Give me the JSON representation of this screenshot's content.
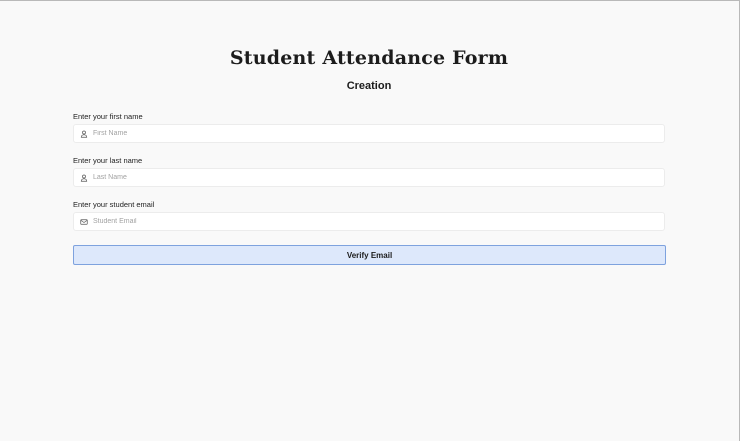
{
  "header": {
    "title": "Student Attendance Form",
    "subtitle": "Creation"
  },
  "form": {
    "fields": [
      {
        "label": "Enter your first name",
        "placeholder": "First Name",
        "value": "",
        "icon": "user-icon"
      },
      {
        "label": "Enter your last name",
        "placeholder": "Last Name",
        "value": "",
        "icon": "user-icon"
      },
      {
        "label": "Enter your student email",
        "placeholder": "Student Email",
        "value": "",
        "icon": "mail-icon"
      }
    ],
    "submit_label": "Verify Email"
  },
  "colors": {
    "background": "#f9f9f9",
    "button_background": "#dde8fb",
    "button_border": "#7ea2de"
  }
}
